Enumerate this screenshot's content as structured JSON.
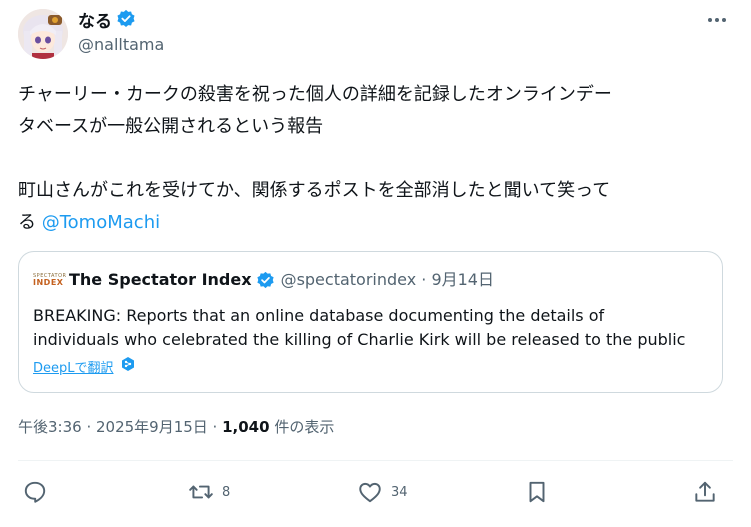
{
  "author": {
    "name": "なる",
    "handle": "@nalltama"
  },
  "tweet": {
    "text": "チャーリー・カークの殺害を祝った個人の詳細を記録したオンラインデー\nタベースが一般公開されるという報告\n\n町山さんがこれを受けてか、関係するポストを全部消したと聞いて笑って\nる ",
    "mention": "@TomoMachi"
  },
  "quote": {
    "logo_line1": "SPECTATOR",
    "logo_line2": "INDEX",
    "name": "The Spectator Index",
    "handle": "@spectatorindex · 9月14日",
    "text": "BREAKING: Reports that an online database documenting the details of\nindividuals who celebrated the killing of Charlie Kirk will be released to the public",
    "translate_label": "DeepLで翻訳"
  },
  "meta": {
    "time": "午後3:36 · 2025年9月15日 · ",
    "views": "1,040",
    "views_suffix": " 件の表示"
  },
  "actions": {
    "reply_count": "",
    "retweet_count": "8",
    "like_count": "34"
  },
  "colors": {
    "accent": "#1d9bf0",
    "muted": "#536471",
    "border": "#cfd9de"
  }
}
